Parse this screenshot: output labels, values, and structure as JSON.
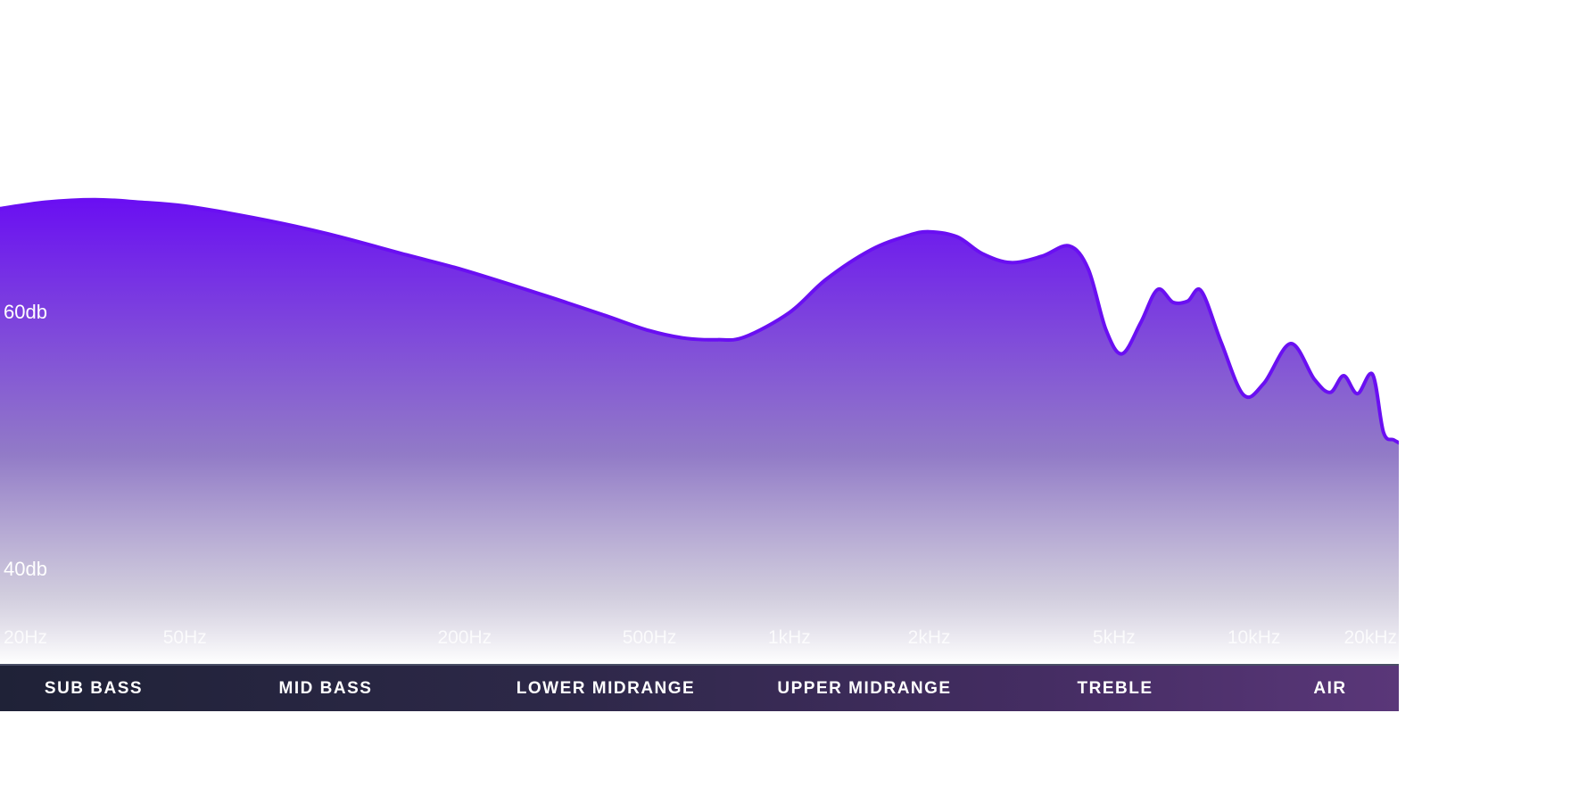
{
  "chart_data": {
    "type": "area",
    "title": "",
    "xlabel": "",
    "ylabel": "",
    "x_scale": "log",
    "xlim_hz": [
      20,
      20500
    ],
    "y_ticks": [
      {
        "value": 60,
        "label": "60db"
      },
      {
        "value": 40,
        "label": "40db"
      }
    ],
    "x_ticks": [
      {
        "value": 20,
        "label": "20Hz"
      },
      {
        "value": 50,
        "label": "50Hz"
      },
      {
        "value": 200,
        "label": "200Hz"
      },
      {
        "value": 500,
        "label": "500Hz"
      },
      {
        "value": 1000,
        "label": "1kHz"
      },
      {
        "value": 2000,
        "label": "2kHz"
      },
      {
        "value": 5000,
        "label": "5kHz"
      },
      {
        "value": 10000,
        "label": "10kHz"
      },
      {
        "value": 20000,
        "label": "20kHz"
      }
    ],
    "series": [
      {
        "color": "#6a0ff2",
        "points": [
          [
            20,
            68.0
          ],
          [
            25,
            68.5
          ],
          [
            32,
            68.7
          ],
          [
            40,
            68.5
          ],
          [
            50,
            68.2
          ],
          [
            70,
            67.3
          ],
          [
            100,
            66.1
          ],
          [
            150,
            64.4
          ],
          [
            200,
            63.2
          ],
          [
            300,
            61.2
          ],
          [
            400,
            59.7
          ],
          [
            500,
            58.5
          ],
          [
            600,
            57.9
          ],
          [
            700,
            57.8
          ],
          [
            800,
            58.0
          ],
          [
            1000,
            59.9
          ],
          [
            1200,
            62.5
          ],
          [
            1500,
            64.8
          ],
          [
            1800,
            65.9
          ],
          [
            2000,
            66.2
          ],
          [
            2300,
            65.8
          ],
          [
            2600,
            64.5
          ],
          [
            3000,
            63.8
          ],
          [
            3500,
            64.3
          ],
          [
            4000,
            65.1
          ],
          [
            4400,
            63.3
          ],
          [
            4800,
            58.6
          ],
          [
            5200,
            56.7
          ],
          [
            5700,
            59.1
          ],
          [
            6200,
            61.7
          ],
          [
            6700,
            60.7
          ],
          [
            7200,
            60.8
          ],
          [
            7700,
            61.6
          ],
          [
            8500,
            57.6
          ],
          [
            9500,
            53.5
          ],
          [
            10500,
            54.4
          ],
          [
            12000,
            57.5
          ],
          [
            13500,
            54.7
          ],
          [
            14600,
            53.7
          ],
          [
            15600,
            55.0
          ],
          [
            16700,
            53.6
          ],
          [
            18000,
            55.1
          ],
          [
            19000,
            50.6
          ],
          [
            20000,
            50.0
          ]
        ]
      }
    ],
    "bands": [
      "SUB BASS",
      "MID BASS",
      "LOWER MIDRANGE",
      "UPPER MIDRANGE",
      "TREBLE",
      "AIR"
    ]
  }
}
